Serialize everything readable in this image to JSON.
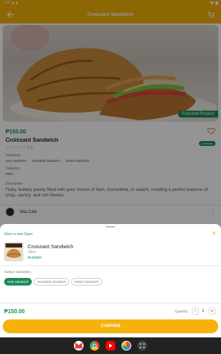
{
  "status_bar": {
    "time": "1:34"
  },
  "app_bar": {
    "title": "Croissant Sandwich",
    "icons": [
      "back-arrow-icon",
      "cart-icon"
    ]
  },
  "product": {
    "price": "₱150.00",
    "name": "Croissant Sandwich",
    "badge": "Featured Product",
    "availability_pill": "Available",
    "rating_value": "0.0",
    "variations_label": "Variations",
    "variations": [
      "Ham Sandwich",
      "Mortadela Sandwich",
      "Salami Sandwich"
    ],
    "category_label": "Category",
    "category": "Other",
    "description_label": "Description",
    "description": "Flaky, buttery pastry filled with your choice of ham, mortadella, or salami, creating a perfect balance of crisp, savory, and rich flavors.",
    "store_name": "Villa Cafe"
  },
  "sheet": {
    "store_status": "Store is now Open",
    "title": "Croissant Sandwich",
    "category": "Other",
    "availability": "Available",
    "select_variation_label": "Select Variation",
    "chips": [
      {
        "label": "Ham Sandwich",
        "selected": true
      },
      {
        "label": "Mortadela Sandwich",
        "selected": false
      },
      {
        "label": "Salami Sandwich",
        "selected": false
      }
    ],
    "price": "₱150.00",
    "quantity_label": "Quantity",
    "quantity": "1",
    "minus": "−",
    "plus": "+",
    "confirm_label": "CONFIRM"
  },
  "nav_apps": [
    "gmail-icon",
    "chrome-icon",
    "youtube-icon",
    "photos-icon",
    "app-drawer-icon"
  ],
  "colors": {
    "accent": "#f4b20a",
    "green": "#1e8a5a"
  }
}
